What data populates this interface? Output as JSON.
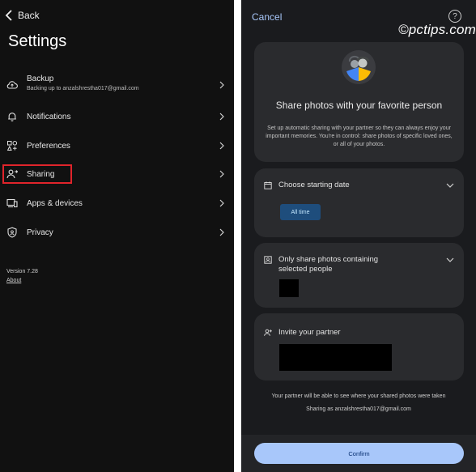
{
  "left": {
    "back_label": "Back",
    "title": "Settings",
    "items": [
      {
        "label": "Backup",
        "sub": "Backing up to anzalshrestha017@gmail.com",
        "icon": "cloud-upload-icon"
      },
      {
        "label": "Notifications",
        "icon": "bell-icon"
      },
      {
        "label": "Preferences",
        "icon": "preferences-icon"
      },
      {
        "label": "Sharing",
        "icon": "people-share-icon"
      },
      {
        "label": "Apps & devices",
        "icon": "devices-icon"
      },
      {
        "label": "Privacy",
        "icon": "shield-icon"
      }
    ],
    "version": "Version 7.28",
    "about": "About"
  },
  "right": {
    "cancel_label": "Cancel",
    "watermark": "©pctips.com",
    "intro": {
      "title": "Share photos with your favorite person",
      "description": "Set up automatic sharing with your partner so they can always enjoy your important memories. You're in control: share photos of specific loved ones, or all of your photos."
    },
    "date": {
      "label": "Choose starting date",
      "chip": "All time"
    },
    "people": {
      "label_line1": "Only share photos containing",
      "label_line2": "selected people"
    },
    "invite": {
      "label": "Invite your partner"
    },
    "footer_line1": "Your partner will be able to see where your shared photos were taken",
    "footer_line2": "Sharing as anzalshrestha017@gmail.com",
    "confirm_label": "Confirm"
  },
  "colors": {
    "accent": "#a8c7fa",
    "highlight_border": "#e0242b",
    "chip_bg": "#1e4d7c",
    "left_bg": "#111111",
    "right_bg": "#1a1b1e",
    "card_bg": "#2a2b2e"
  }
}
